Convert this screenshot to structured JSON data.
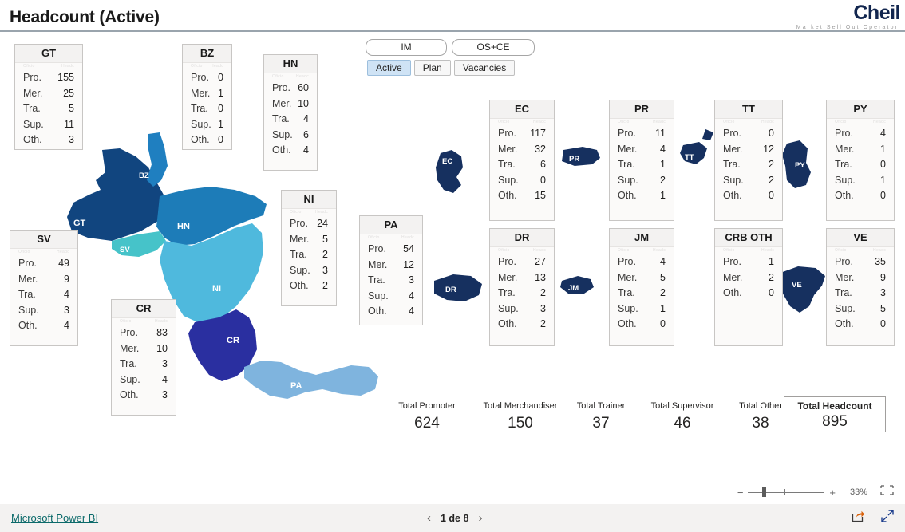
{
  "header": {
    "title": "Headcount (Active)",
    "logo": {
      "part_m": "M",
      "part_s": "S",
      "part_o": "O",
      "brand": "Cheil",
      "tagline": "Market Sell Out Operator"
    }
  },
  "slicers": {
    "channel": [
      {
        "label": "IM",
        "selected": false
      },
      {
        "label": "OS+CE",
        "selected": false
      }
    ],
    "status": [
      {
        "label": "Active",
        "selected": true
      },
      {
        "label": "Plan",
        "selected": false
      },
      {
        "label": "Vacancies",
        "selected": false
      }
    ]
  },
  "row_labels": {
    "promoter": "Pro.",
    "merchandiser": "Mer.",
    "trainer": "Tra.",
    "supervisor": "Sup.",
    "other": "Oth."
  },
  "ghost": {
    "left": "Oficio",
    "right": "Headc"
  },
  "cards": [
    {
      "code": "GT",
      "rows": [
        [
          "Pro.",
          "155"
        ],
        [
          "Mer.",
          "25"
        ],
        [
          "Tra.",
          "5"
        ],
        [
          "Sup.",
          "11"
        ],
        [
          "Oth.",
          "3"
        ]
      ]
    },
    {
      "code": "BZ",
      "rows": [
        [
          "Pro.",
          "0"
        ],
        [
          "Mer.",
          "1"
        ],
        [
          "Tra.",
          "0"
        ],
        [
          "Sup.",
          "1"
        ],
        [
          "Oth.",
          "0"
        ]
      ]
    },
    {
      "code": "HN",
      "rows": [
        [
          "Pro.",
          "60"
        ],
        [
          "Mer.",
          "10"
        ],
        [
          "Tra.",
          "4"
        ],
        [
          "Sup.",
          "6"
        ],
        [
          "Oth.",
          "4"
        ]
      ]
    },
    {
      "code": "SV",
      "rows": [
        [
          "Pro.",
          "49"
        ],
        [
          "Mer.",
          "9"
        ],
        [
          "Tra.",
          "4"
        ],
        [
          "Sup.",
          "3"
        ],
        [
          "Oth.",
          "4"
        ]
      ]
    },
    {
      "code": "CR",
      "rows": [
        [
          "Pro.",
          "83"
        ],
        [
          "Mer.",
          "10"
        ],
        [
          "Tra.",
          "3"
        ],
        [
          "Sup.",
          "4"
        ],
        [
          "Oth.",
          "3"
        ]
      ]
    },
    {
      "code": "NI",
      "rows": [
        [
          "Pro.",
          "24"
        ],
        [
          "Mer.",
          "5"
        ],
        [
          "Tra.",
          "2"
        ],
        [
          "Sup.",
          "3"
        ],
        [
          "Oth.",
          "2"
        ]
      ]
    },
    {
      "code": "PA",
      "rows": [
        [
          "Pro.",
          "54"
        ],
        [
          "Mer.",
          "12"
        ],
        [
          "Tra.",
          "3"
        ],
        [
          "Sup.",
          "4"
        ],
        [
          "Oth.",
          "4"
        ]
      ]
    },
    {
      "code": "EC",
      "rows": [
        [
          "Pro.",
          "117"
        ],
        [
          "Mer.",
          "32"
        ],
        [
          "Tra.",
          "6"
        ],
        [
          "Sup.",
          "0"
        ],
        [
          "Oth.",
          "15"
        ]
      ]
    },
    {
      "code": "PR",
      "rows": [
        [
          "Pro.",
          "11"
        ],
        [
          "Mer.",
          "4"
        ],
        [
          "Tra.",
          "1"
        ],
        [
          "Sup.",
          "2"
        ],
        [
          "Oth.",
          "1"
        ]
      ]
    },
    {
      "code": "TT",
      "rows": [
        [
          "Pro.",
          "0"
        ],
        [
          "Mer.",
          "12"
        ],
        [
          "Tra.",
          "2"
        ],
        [
          "Sup.",
          "2"
        ],
        [
          "Oth.",
          "0"
        ]
      ]
    },
    {
      "code": "PY",
      "rows": [
        [
          "Pro.",
          "4"
        ],
        [
          "Mer.",
          "1"
        ],
        [
          "Tra.",
          "0"
        ],
        [
          "Sup.",
          "1"
        ],
        [
          "Oth.",
          "0"
        ]
      ]
    },
    {
      "code": "DR",
      "rows": [
        [
          "Pro.",
          "27"
        ],
        [
          "Mer.",
          "13"
        ],
        [
          "Tra.",
          "2"
        ],
        [
          "Sup.",
          "3"
        ],
        [
          "Oth.",
          "2"
        ]
      ]
    },
    {
      "code": "JM",
      "rows": [
        [
          "Pro.",
          "4"
        ],
        [
          "Mer.",
          "5"
        ],
        [
          "Tra.",
          "2"
        ],
        [
          "Sup.",
          "1"
        ],
        [
          "Oth.",
          "0"
        ]
      ]
    },
    {
      "code": "CRB OTH",
      "rows": [
        [
          "Pro.",
          "1"
        ],
        [
          "Mer.",
          "2"
        ],
        [
          "Oth.",
          "0"
        ]
      ]
    },
    {
      "code": "VE",
      "rows": [
        [
          "Pro.",
          "35"
        ],
        [
          "Mer.",
          "9"
        ],
        [
          "Tra.",
          "3"
        ],
        [
          "Sup.",
          "5"
        ],
        [
          "Oth.",
          "0"
        ]
      ]
    }
  ],
  "map": {
    "regions": [
      {
        "code": "GT",
        "color": "#11457f"
      },
      {
        "code": "BZ",
        "color": "#1f7fc0"
      },
      {
        "code": "HN",
        "color": "#1d7cb8"
      },
      {
        "code": "SV",
        "color": "#46c3c9"
      },
      {
        "code": "NI",
        "color": "#4fb9dd"
      },
      {
        "code": "CR",
        "color": "#2a2fa0"
      },
      {
        "code": "PA",
        "color": "#7fb4de"
      }
    ],
    "inset_shapes": [
      {
        "code": "EC",
        "color": "#16305f"
      },
      {
        "code": "PR",
        "color": "#16305f"
      },
      {
        "code": "TT",
        "color": "#16305f"
      },
      {
        "code": "PY",
        "color": "#16305f"
      },
      {
        "code": "DR",
        "color": "#16305f"
      },
      {
        "code": "JM",
        "color": "#16305f"
      },
      {
        "code": "VE",
        "color": "#16305f"
      }
    ]
  },
  "totals": [
    {
      "label": "Total Promoter",
      "value": "624"
    },
    {
      "label": "Total Merchandiser",
      "value": "150"
    },
    {
      "label": "Total Trainer",
      "value": "37"
    },
    {
      "label": "Total Supervisor",
      "value": "46"
    },
    {
      "label": "Total Other",
      "value": "38"
    }
  ],
  "grand_total": {
    "label": "Total Headcount",
    "value": "895"
  },
  "footer": {
    "zoom_minus": "−",
    "zoom_plus": "+",
    "zoom_level": "33%",
    "brand_link": "Microsoft Power BI",
    "page_indicator": "1 de 8",
    "prev_arrow": "‹",
    "next_arrow": "›"
  }
}
